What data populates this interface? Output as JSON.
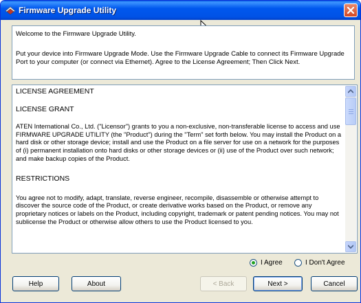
{
  "window": {
    "title": "Firmware Upgrade Utility"
  },
  "intro": {
    "welcome": "Welcome to the Firmware Upgrade Utility.",
    "instructions": "Put your device into Firmware Upgrade Mode. Use the Firmware Upgrade Cable to connect its Firmware Upgrade Port to your computer (or connect via Ethernet). Agree to the License Agreement; Then Click Next."
  },
  "license": {
    "heading": "LICENSE AGREEMENT",
    "grant_heading": "LICENSE GRANT",
    "grant_text": "ATEN International Co., Ltd. (\"Licensor\") grants to you a non-exclusive, non-transferable license to access and use FIRMWARE UPGRADE UTILITY (the \"Product\") during the \"Term\" set forth below. You may install the Product on a hard disk or other storage device; install and use the Product on a file server for use on a network for the purposes of (i) permanent installation onto hard disks or other storage devices or (ii) use of the Product over such network; and make backup copies of the Product.",
    "restrictions_heading": "RESTRICTIONS",
    "restrictions_text": "You agree not to modify, adapt, translate, reverse engineer, recompile, disassemble or otherwise attempt to discover the source code of the Product, or create derivative works based on the Product, or remove any proprietary notices or labels on the Product, including copyright, trademark or patent pending notices. You may not sublicense the Product or otherwise allow others to use the Product licensed to you."
  },
  "agreement": {
    "agree_label": "I Agree",
    "disagree_label": "I Don't Agree",
    "selected": "agree"
  },
  "buttons": {
    "help": "Help",
    "about": "About",
    "back": "< Back",
    "next": "Next >",
    "cancel": "Cancel"
  },
  "icons": {
    "app": "firmware-utility-icon",
    "close": "close-icon",
    "cursor": "mouse-cursor-icon",
    "scroll_up": "arrow-up-icon",
    "scroll_down": "arrow-down-icon"
  },
  "colors": {
    "titlebar": "#0058ee",
    "close": "#d44824",
    "radio_selected": "#21a121"
  }
}
